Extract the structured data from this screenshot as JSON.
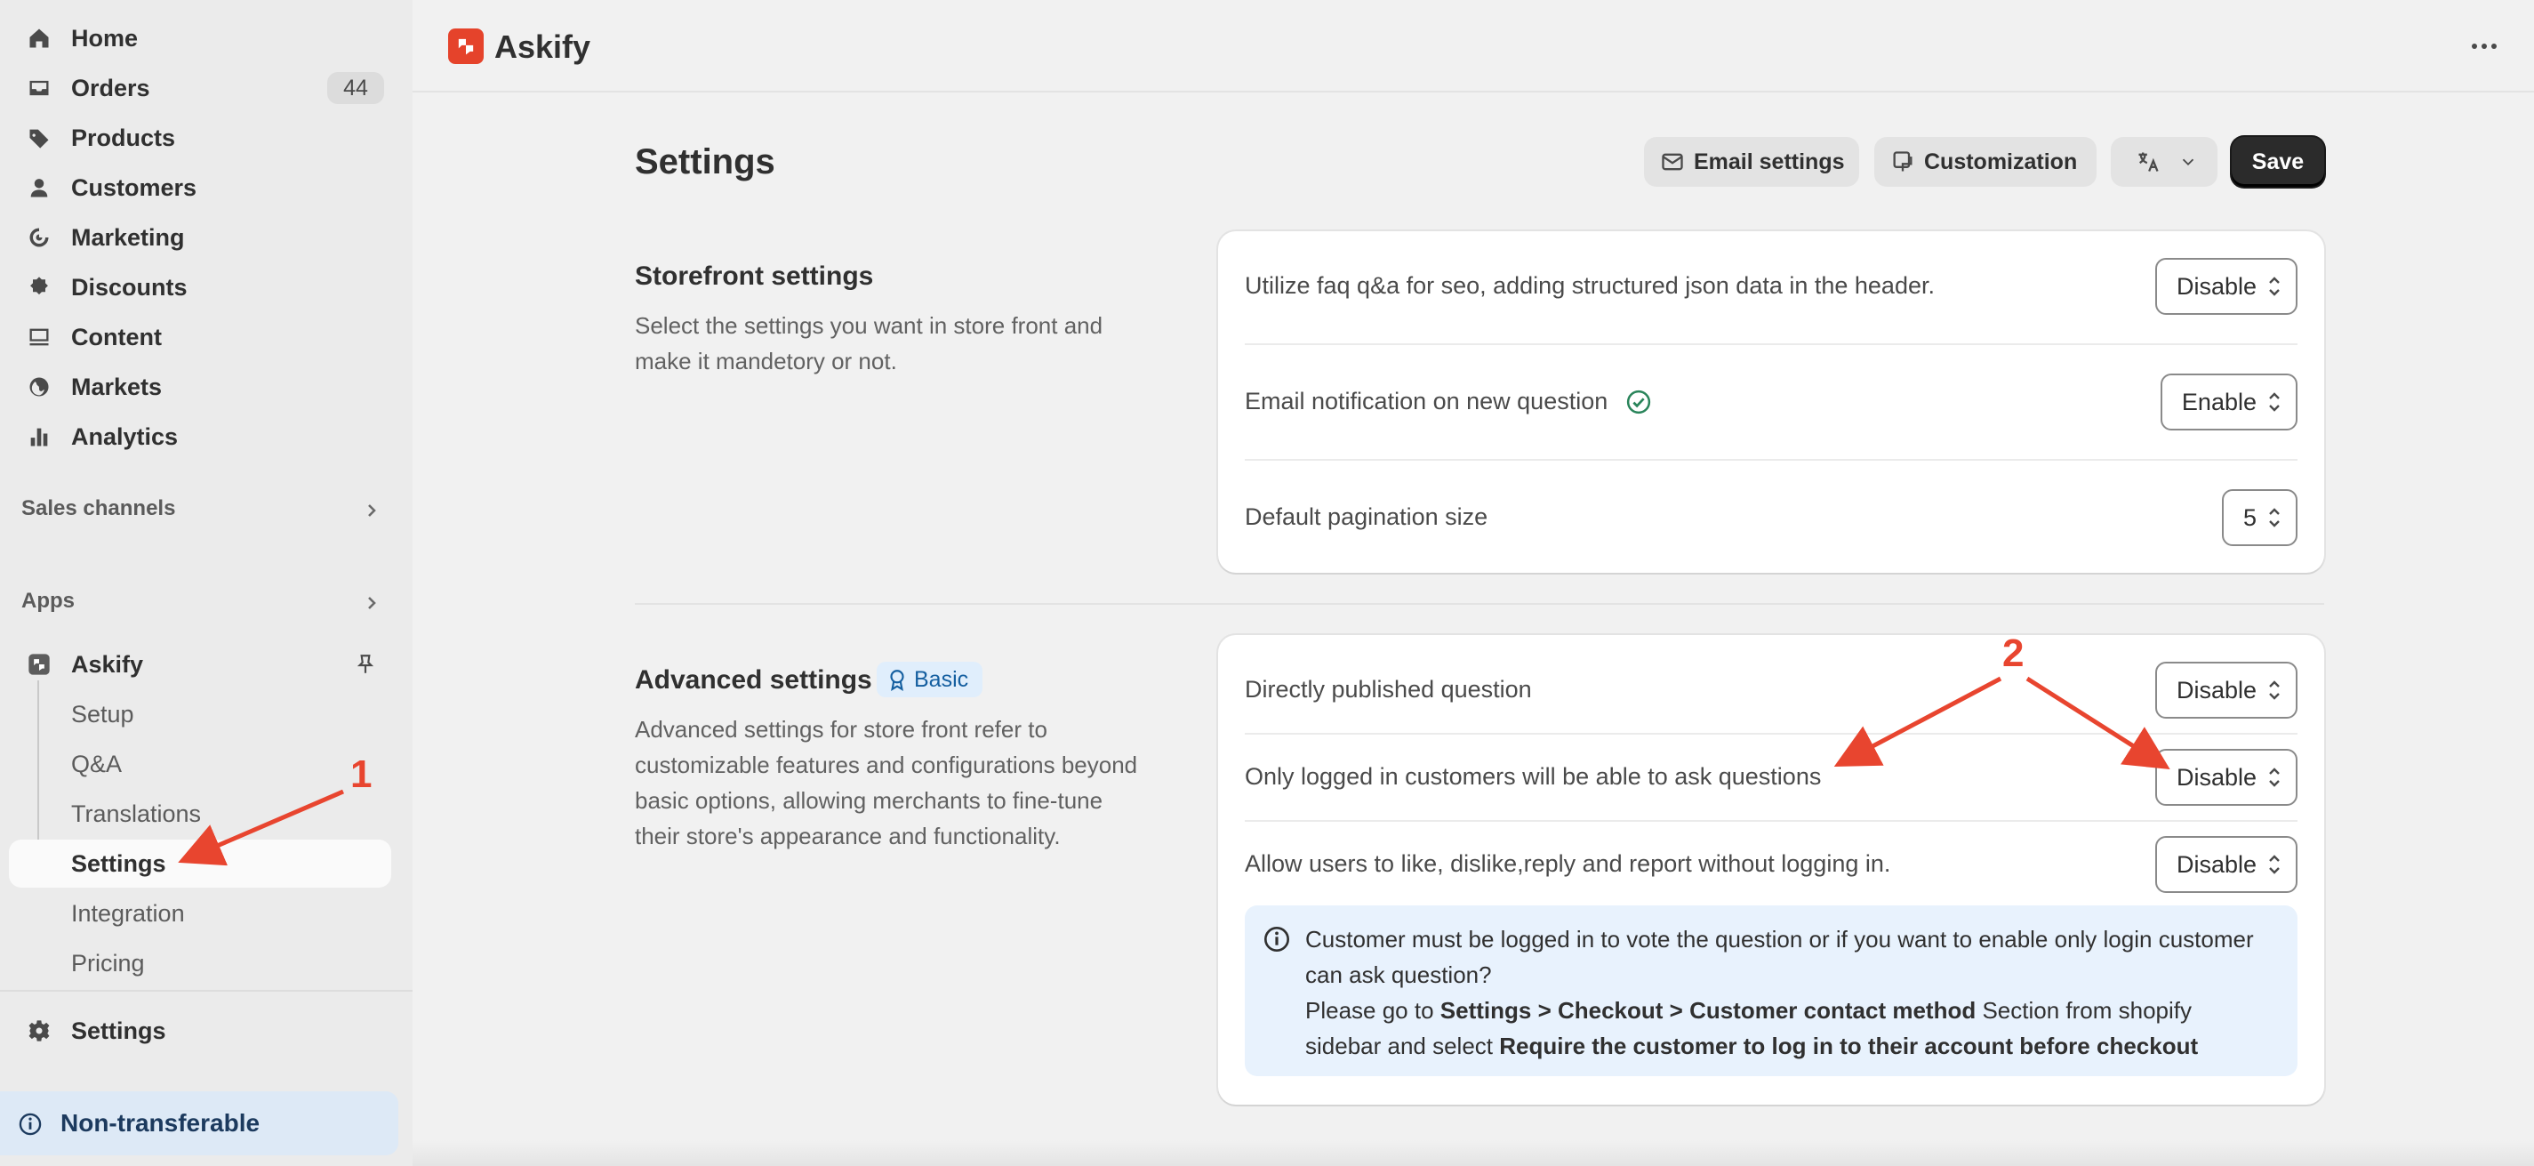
{
  "sidebar": {
    "nav": [
      {
        "label": "Home",
        "icon": "home-icon"
      },
      {
        "label": "Orders",
        "icon": "orders-icon",
        "badge": "44"
      },
      {
        "label": "Products",
        "icon": "tag-icon"
      },
      {
        "label": "Customers",
        "icon": "person-icon"
      },
      {
        "label": "Marketing",
        "icon": "target-icon"
      },
      {
        "label": "Discounts",
        "icon": "discount-icon"
      },
      {
        "label": "Content",
        "icon": "content-icon"
      },
      {
        "label": "Markets",
        "icon": "globe-icon"
      },
      {
        "label": "Analytics",
        "icon": "bar-chart-icon"
      }
    ],
    "sales_channels": "Sales channels",
    "apps": "Apps",
    "app": {
      "label": "Askify"
    },
    "sub_items": [
      "Setup",
      "Q&A",
      "Translations",
      "Settings",
      "Integration",
      "Pricing"
    ],
    "settings": "Settings",
    "non_transferable": "Non-transferable"
  },
  "topbar": {
    "app_name": "Askify"
  },
  "page": {
    "title": "Settings",
    "buttons": {
      "email_settings": "Email settings",
      "customization": "Customization",
      "save": "Save"
    }
  },
  "storefront": {
    "title": "Storefront settings",
    "description": "Select the settings you want in store front and make it mandetory or not.",
    "rows": [
      {
        "label": "Utilize faq q&a for seo, adding structured json data in the header.",
        "value": "Disable"
      },
      {
        "label": "Email notification on new question",
        "value": "Enable"
      },
      {
        "label": "Default pagination size",
        "value": "5"
      }
    ]
  },
  "advanced": {
    "title": "Advanced settings",
    "badge": "Basic",
    "description": "Advanced settings for store front refer to customizable features and configurations beyond basic options, allowing merchants to fine-tune their store's appearance and functionality.",
    "rows": [
      {
        "label": "Directly published question",
        "value": "Disable"
      },
      {
        "label": "Only logged in customers will be able to ask questions",
        "value": "Disable"
      },
      {
        "label": "Allow users to like, dislike,reply and report without logging in.",
        "value": "Disable"
      }
    ],
    "info": {
      "line1": "Customer must be logged in to vote the question or if you want to enable only login customer can ask question?",
      "line2_pre": "Please go to ",
      "line2_bold": "Settings > Checkout > Customer contact method",
      "line2_mid": " Section from shopify sidebar and select ",
      "line2_bold2": "Require the customer to log in to their account before checkout"
    }
  },
  "annotations": {
    "label1": "1",
    "label2": "2"
  },
  "colors": {
    "accent_red": "#e8452f",
    "info_bg": "#e8f2fd",
    "badge_blue": "#155fa0"
  }
}
